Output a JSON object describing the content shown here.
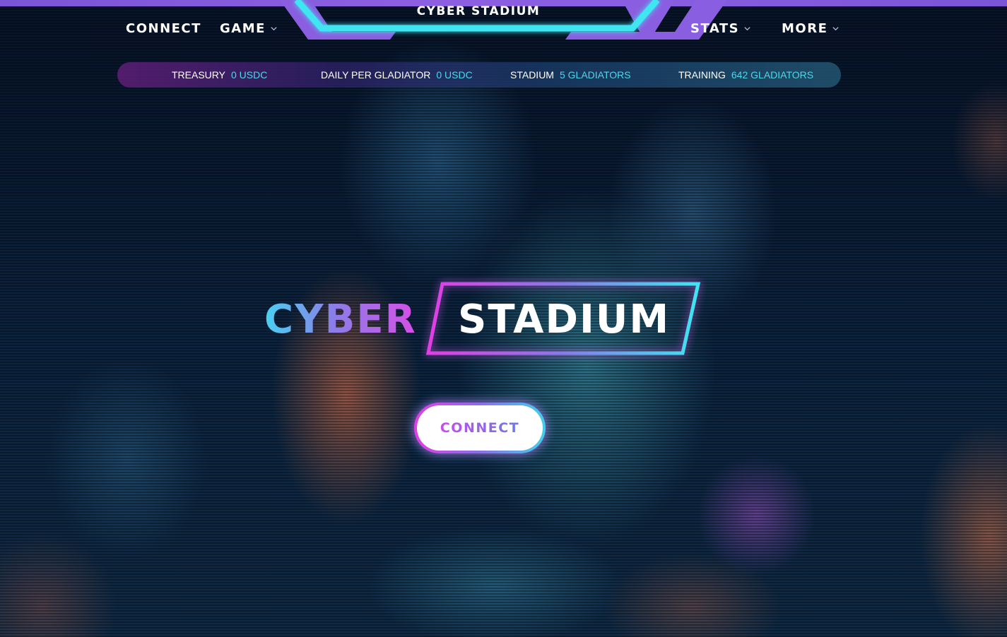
{
  "header": {
    "site_title": "CYBER STADIUM",
    "nav_left": [
      {
        "label": "CONNECT"
      },
      {
        "label": "GAME"
      }
    ],
    "nav_right": [
      {
        "label": "STATS"
      },
      {
        "label": "MORE"
      }
    ]
  },
  "stats_bar": [
    {
      "label": "TREASURY",
      "value": "0 USDC"
    },
    {
      "label": "DAILY PER GLADIATOR",
      "value": "0 USDC"
    },
    {
      "label": "STADIUM",
      "value": "5 GLADIATORS"
    },
    {
      "label": "TRAINING",
      "value": "642 GLADIATORS"
    }
  ],
  "hero": {
    "title_part1": "CYBER",
    "title_part2": "STADIUM",
    "connect_label": "CONNECT"
  },
  "colors": {
    "cyan": "#3fe6f2",
    "purple": "#8a5ee0",
    "magenta": "#e23ee6",
    "value_text": "#4fd6ea"
  },
  "icons": [
    "chevron-down-icon"
  ]
}
